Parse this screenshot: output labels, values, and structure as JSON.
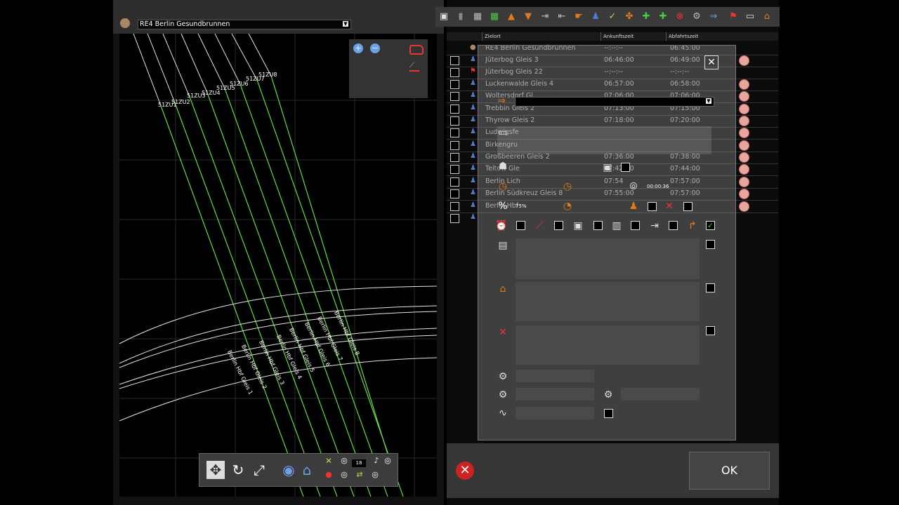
{
  "route_selector": {
    "value": "RE4 Berlin Gesundbrunnen",
    "arrow": "▼"
  },
  "map": {
    "signals": [
      "51ZU1",
      "51ZU2",
      "51ZU3",
      "51ZU4",
      "51ZU5",
      "51ZU6",
      "51ZU7",
      "51ZU8"
    ],
    "platforms": [
      "Berlin Hbf Gleis 1",
      "Berlin Hbf Gleis 2",
      "Berlin Hbf Gleis 3",
      "Berlin Hbf Gleis 4",
      "Berlin Hbf Gleis 5",
      "Berlin Hbf Gleis 6",
      "Berlin Hbf Gleis 7",
      "Berlin Hbf Gleis 8"
    ],
    "zoom_level": "18"
  },
  "table": {
    "headers": {
      "zielort": "Zielort",
      "ankunft": "Ankunftszeit",
      "abfahrt": "Abfahrtszeit"
    },
    "rows": [
      {
        "name": "RE4 Berlin Gesundbrunnen",
        "arrival": "--:--:--",
        "departure": "06:45:00"
      },
      {
        "name": "Jüterbog Gleis 3",
        "arrival": "06:46:00",
        "departure": "06:49:00"
      },
      {
        "name": "Jüterbog Gleis 22",
        "arrival": "--:--:--",
        "departure": "--:--:--"
      },
      {
        "name": "Luckenwalde Gleis 4",
        "arrival": "06:57:00",
        "departure": "06:58:00"
      },
      {
        "name": "Woltersdorf Gl",
        "arrival": "07:06:00",
        "departure": "07:06:00"
      },
      {
        "name": "Trebbin Gleis 2",
        "arrival": "07:13:00",
        "departure": "07:15:00"
      },
      {
        "name": "Thyrow Gleis 2",
        "arrival": "07:18:00",
        "departure": "07:20:00"
      },
      {
        "name": "Ludwigsfe",
        "arrival": "",
        "departure": ""
      },
      {
        "name": "Birkengru",
        "arrival": "",
        "departure": ""
      },
      {
        "name": "Großbeeren Gleis 2",
        "arrival": "07:36:00",
        "departure": "07:38:00"
      },
      {
        "name": "Teltow Gle",
        "arrival": "07:42:00",
        "departure": "07:44:00"
      },
      {
        "name": "Berlin Lich",
        "arrival": "07:54",
        "departure": "07:57:00"
      },
      {
        "name": "Berlin Südkreuz Gleis 8",
        "arrival": "07:55:00",
        "departure": "07:57:00"
      },
      {
        "name": "Berlin Hbf",
        "arrival": "",
        "departure": ""
      },
      {
        "name": "",
        "arrival": "",
        "departure": ""
      }
    ]
  },
  "dialog": {
    "duration": "00:00:36",
    "percent": "75%",
    "ok_label": "OK"
  },
  "colors": {
    "track_green": "#66dd44",
    "accent_orange": "#e07a1a"
  }
}
